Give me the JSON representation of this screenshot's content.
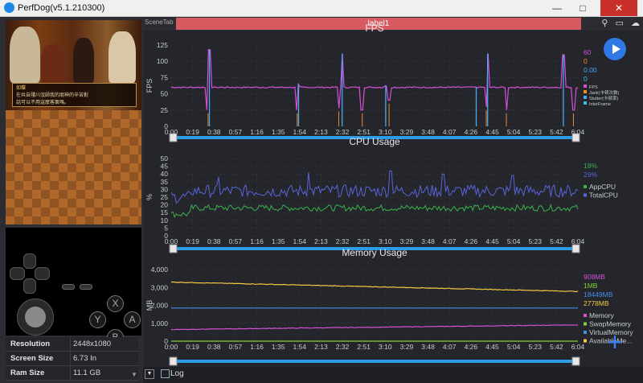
{
  "window": {
    "title": "PerfDog(v5.1.210300)",
    "minimize": "—",
    "maximize": "□",
    "close": "✕"
  },
  "tabs": {
    "scene_tab": "SceneTab",
    "active_label": "label1"
  },
  "top_icons": [
    "location-pin-icon",
    "folder-icon",
    "cloud-icon"
  ],
  "game": {
    "speaker": "如蝶",
    "dialog_line1": "在共自殘川沒師我的朋神的辛苦對",
    "dialog_line2": "話可以不用這麼客氣嗎。"
  },
  "gamepad": {
    "face_buttons": [
      "X",
      "Y",
      "A",
      "B"
    ]
  },
  "device_info": [
    {
      "key": "Resolution",
      "value": "2448x1080"
    },
    {
      "key": "Screen Size",
      "value": "6.73 In"
    },
    {
      "key": "Ram Size",
      "value": "11.1 GB"
    }
  ],
  "bottombar": {
    "expand": "▼",
    "log_label": "Log"
  },
  "colors": {
    "fps": "#d64fd6",
    "jank": "#f28a2e",
    "stutter": "#4aa8f0",
    "interframe": "#39c0d8",
    "app_cpu": "#3ab34a",
    "total_cpu": "#5865d8",
    "memory": "#d64fd6",
    "swap": "#7fd33a",
    "virtual": "#4a8ee6",
    "available": "#f5c842",
    "accent": "#2f78e6",
    "tab_label": "#d65a5f"
  },
  "x_ticks": [
    "0:00",
    "0:19",
    "0:38",
    "0:57",
    "1:16",
    "1:35",
    "1:54",
    "2:13",
    "2:32",
    "2:51",
    "3:10",
    "3:29",
    "3:48",
    "4:07",
    "4:26",
    "4:45",
    "5:04",
    "5:23",
    "5:42",
    "6:04"
  ],
  "chart_data": [
    {
      "type": "line",
      "title": "FPS",
      "ylabel": "FPS",
      "ylim": [
        0,
        125
      ],
      "yticks": [
        "0",
        "25",
        "50",
        "75",
        "100",
        "125"
      ],
      "legend_values": [
        "60",
        "0",
        "0.00",
        "0"
      ],
      "series": [
        {
          "name": "FPS",
          "base": 60,
          "values": [
            60,
            60,
            60,
            60,
            58,
            60,
            60,
            60,
            60,
            60,
            60,
            60,
            60,
            60,
            60,
            60,
            60,
            60,
            60,
            60,
            60,
            60,
            60,
            60,
            60,
            60,
            60,
            60,
            60,
            60,
            60,
            60,
            60,
            60,
            60,
            60,
            60,
            60,
            60,
            60,
            60,
            60,
            60,
            60,
            60,
            60,
            60,
            60,
            60,
            60,
            60,
            60,
            60,
            60,
            60,
            60,
            60,
            60,
            60,
            60
          ]
        },
        {
          "name": "Jank(卡顿次数)",
          "values": []
        },
        {
          "name": "Stutter(卡顿率)",
          "values": []
        },
        {
          "name": "InterFrame",
          "values": []
        }
      ],
      "spikes": [
        {
          "t": 0.57,
          "v": 118
        },
        {
          "t": 1.9,
          "v": 65
        },
        {
          "t": 2.55,
          "v": 112
        },
        {
          "t": 3.2,
          "v": 62
        },
        {
          "t": 4.55,
          "v": 60
        },
        {
          "t": 4.72,
          "v": 112
        },
        {
          "t": 5.85,
          "v": 110
        }
      ],
      "dips": [
        {
          "t": 0.55,
          "v": 5
        },
        {
          "t": 1.88,
          "v": 5
        },
        {
          "t": 2.5,
          "v": 8
        },
        {
          "t": 2.85,
          "v": 5
        },
        {
          "t": 3.25,
          "v": 20
        },
        {
          "t": 4.7,
          "v": 10
        },
        {
          "t": 5.0,
          "v": 5
        },
        {
          "t": 6.0,
          "v": 5
        }
      ]
    },
    {
      "type": "line",
      "title": "CPU Usage",
      "ylabel": "%",
      "ylim": [
        0,
        50
      ],
      "yticks": [
        "0",
        "5",
        "10",
        "15",
        "20",
        "25",
        "30",
        "35",
        "40",
        "45",
        "50"
      ],
      "legend_values": [
        "18%",
        "29%"
      ],
      "series": [
        {
          "name": "AppCPU",
          "mean": 18,
          "noise": 2
        },
        {
          "name": "TotalCPU",
          "mean": 29,
          "noise": 4
        }
      ],
      "peaks": [
        {
          "t": 0.71,
          "v": 38
        },
        {
          "t": 2.05,
          "v": 41
        },
        {
          "t": 3.28,
          "v": 42
        },
        {
          "t": 4.05,
          "v": 40
        },
        {
          "t": 5.1,
          "v": 39
        }
      ]
    },
    {
      "type": "line",
      "title": "Memory Usage",
      "ylabel": "MB",
      "ylim": [
        0,
        4000
      ],
      "yticks": [
        "0",
        "1,000",
        "2,000",
        "3,000",
        "4,000"
      ],
      "legend_values": [
        "908MB",
        "1MB",
        "18449MB",
        "2778MB"
      ],
      "series": [
        {
          "name": "Memory",
          "start": 650,
          "end": 908
        },
        {
          "name": "SwapMemory",
          "start": 1,
          "end": 1
        },
        {
          "name": "VirtualMemory",
          "start": 1850,
          "end": 1850
        },
        {
          "name": "AvailableMe...",
          "start": 3300,
          "end": 2778
        }
      ]
    }
  ]
}
